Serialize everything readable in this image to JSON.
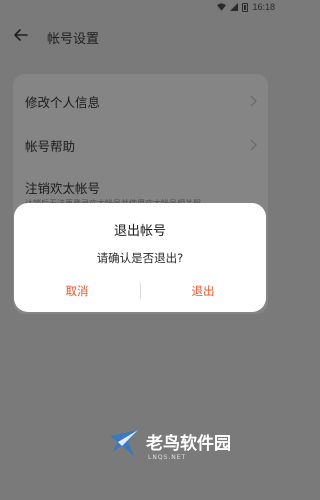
{
  "status_bar": {
    "time": "16:18",
    "icons": [
      "wifi-icon",
      "signal-icon",
      "battery-icon"
    ]
  },
  "header": {
    "back_icon": "back-arrow-icon",
    "title": "帐号设置"
  },
  "menu": {
    "items": [
      {
        "label": "修改个人信息",
        "icon": "chevron-right-icon"
      },
      {
        "label": "帐号帮助",
        "icon": "chevron-right-icon"
      },
      {
        "label": "注销欢太帐号",
        "sublabel": "注销后无法再登录欢太帐号并使用欢太帐号相关服"
      }
    ]
  },
  "dialog": {
    "title": "退出帐号",
    "message": "请确认是否退出?",
    "cancel_label": "取消",
    "confirm_label": "退出",
    "accent_color": "#e8562a"
  },
  "watermark": {
    "text": "老鸟软件园",
    "subtext": "LNQS.NET"
  }
}
